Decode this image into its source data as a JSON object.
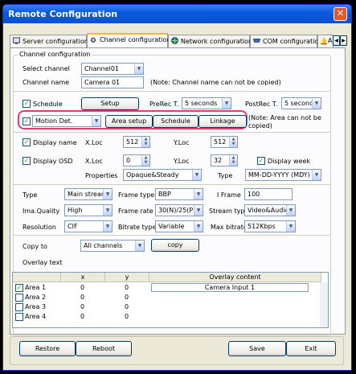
{
  "window": {
    "title": "Remote Configuration",
    "close_glyph": "✕"
  },
  "tabs": [
    {
      "label": "Server configuration",
      "icon": "server-icon"
    },
    {
      "label": "Channel configuration",
      "icon": "gear-icon"
    },
    {
      "label": "Network configuration",
      "icon": "globe-icon"
    },
    {
      "label": "COM configuration",
      "icon": "com-port-icon"
    },
    {
      "label": "A",
      "icon": "bell-icon"
    }
  ],
  "tab_scroll": {
    "left": "◀",
    "right": "▶"
  },
  "channel_group": {
    "label": "Channel configuration"
  },
  "select_channel": {
    "label": "Select channel",
    "value": "Channel01"
  },
  "channel_name": {
    "label": "Channel name",
    "value": "Camera 01",
    "note": "(Note: Channel name can not be copied)"
  },
  "schedule": {
    "label": "Schedule",
    "checked": true,
    "setup_button": "Setup",
    "prerec_label": "PreRec T.",
    "prerec_value": "5 seconds",
    "postrec_label": "PostRec T.",
    "postrec_value": "5 second"
  },
  "motion": {
    "checked": true,
    "value": "Motion Det.",
    "area_setup_button": "Area setup",
    "schedule_button": "Schedule",
    "linkage_button": "Linkage",
    "note": "(Note: Area can not be copied)"
  },
  "display_name": {
    "label": "Display name",
    "checked": true,
    "xloc_label": "X.Loc",
    "xloc_value": "512",
    "yloc_label": "Y.Loc",
    "yloc_value": "512"
  },
  "display_osd": {
    "label": "Display OSD",
    "checked": true,
    "xloc_label": "X.Loc",
    "xloc_value": "0",
    "yloc_label": "Y.Loc",
    "yloc_value": "32",
    "week_label": "Display week",
    "week_checked": true,
    "properties_label": "Properties",
    "properties_value": "Opaque&Steady",
    "type_label": "Type",
    "type_value": "MM-DD-YYYY (MDY)"
  },
  "stream": {
    "type_label": "Type",
    "type_value": "Main stream",
    "frame_type_label": "Frame type",
    "frame_type_value": "BBP",
    "iframe_label": "I Frame",
    "iframe_value": "100",
    "quality_label": "Ima.Quality",
    "quality_value": "High",
    "frame_rate_label": "Frame rate",
    "frame_rate_value": "30(N)/25(P)",
    "stream_type_label": "Stream type",
    "stream_type_value": "Video&Audio",
    "resolution_label": "Resolution",
    "resolution_value": "CIF",
    "bitrate_type_label": "Bitrate type",
    "bitrate_type_value": "Variable",
    "max_bitrate_label": "Max bitrate",
    "max_bitrate_value": "512Kbps"
  },
  "copy": {
    "label": "Copy to",
    "value": "All channels",
    "button": "copy"
  },
  "overlay": {
    "label": "Overlay text",
    "headers": [
      "",
      "x",
      "y",
      "Overlay content"
    ],
    "rows": [
      {
        "name": "Area 1",
        "checked": true,
        "x": "0",
        "y": "0",
        "content": "Camera Input 1"
      },
      {
        "name": "Area 2",
        "checked": false,
        "x": "0",
        "y": "0",
        "content": ""
      },
      {
        "name": "Area 3",
        "checked": false,
        "x": "0",
        "y": "0",
        "content": ""
      },
      {
        "name": "Area 4",
        "checked": false,
        "x": "0",
        "y": "0",
        "content": ""
      }
    ]
  },
  "footer": {
    "restore": "Restore",
    "reboot": "Reboot",
    "save": "Save",
    "exit": "Exit"
  },
  "glyphs": {
    "check": "✓",
    "arrow_down": "▼",
    "spin_up": "▲",
    "spin_down": "▼"
  }
}
